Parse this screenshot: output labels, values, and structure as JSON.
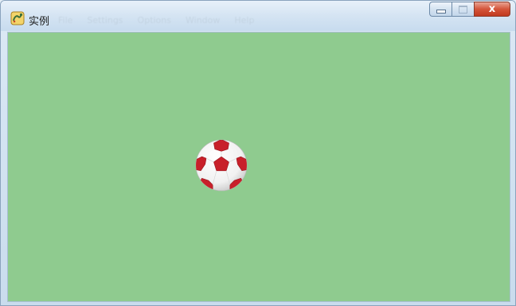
{
  "window": {
    "title": "实例",
    "ghost_menu": [
      "File",
      "Settings",
      "Options",
      "Window",
      "Help"
    ],
    "caption_buttons": {
      "minimize_icon": "minimize-icon",
      "maximize_icon": "maximize-icon",
      "close_label": "x"
    }
  },
  "canvas": {
    "background_color": "#8fcb8f",
    "sprite": {
      "icon": "soccer-ball-icon",
      "colors": [
        "#ffffff",
        "#c8202a"
      ]
    }
  }
}
